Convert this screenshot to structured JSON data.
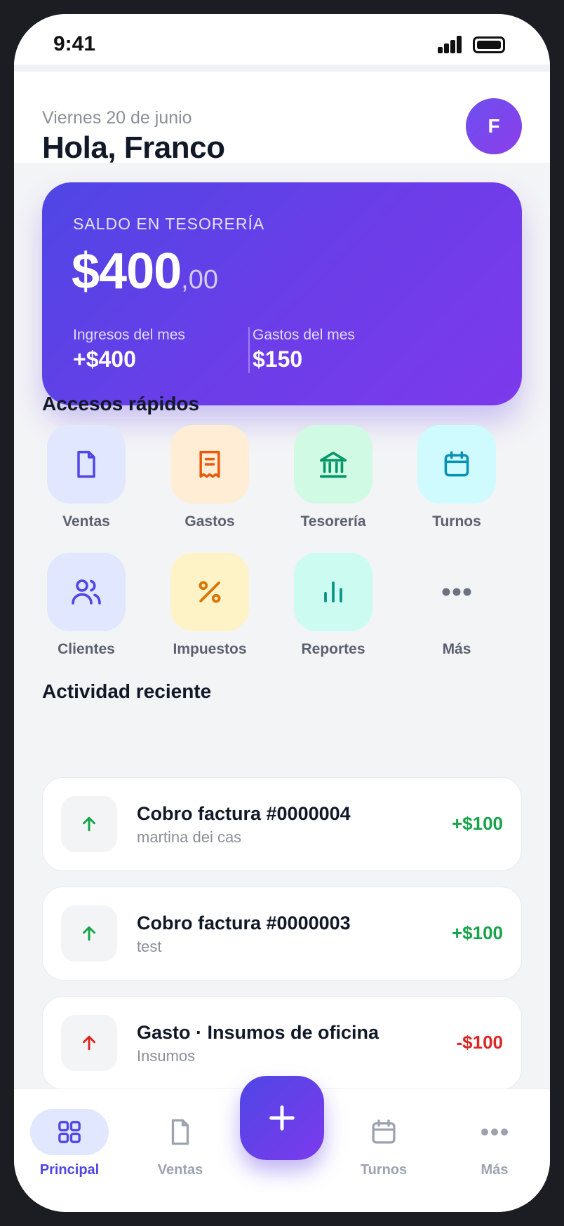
{
  "status_bar": {
    "time": "9:41"
  },
  "header": {
    "date": "Viernes 20 de junio",
    "greeting": "Hola, Franco",
    "avatar_initial": "F"
  },
  "balance": {
    "label": "SALDO EN TESORERÍA",
    "amount": "$400",
    "cents": ",00",
    "income_label": "Ingresos del mes",
    "income_value": "+$400",
    "expenses_label": "Gastos del mes",
    "expenses_value": "$150"
  },
  "quick_access": {
    "title": "Accesos rápidos",
    "items": [
      {
        "label": "Ventas",
        "icon": "document-icon",
        "color": "#4f46e5",
        "bg": "#e0e7ff"
      },
      {
        "label": "Gastos",
        "icon": "receipt-icon",
        "color": "#ea580c",
        "bg": "#ffedd5"
      },
      {
        "label": "Tesorería",
        "icon": "bank-icon",
        "color": "#059669",
        "bg": "#d1fae5"
      },
      {
        "label": "Turnos",
        "icon": "calendar-icon",
        "color": "#0891b2",
        "bg": "#cffafe"
      },
      {
        "label": "Clientes",
        "icon": "users-icon",
        "color": "#4f46e5",
        "bg": "#e0e7ff"
      },
      {
        "label": "Impuestos",
        "icon": "percent-icon",
        "color": "#d97706",
        "bg": "#fef3c7"
      },
      {
        "label": "Reportes",
        "icon": "bar-chart-icon",
        "color": "#0d9488",
        "bg": "#ccfbf1"
      },
      {
        "label": "Más",
        "icon": "more-icon",
        "color": "#6b7280",
        "bg": "transparent"
      }
    ]
  },
  "activity": {
    "title": "Actividad reciente",
    "items": [
      {
        "title": "Cobro factura #0000004",
        "subtitle": "martina dei cas",
        "amount": "+$100",
        "direction": "up",
        "color": "#16a34a"
      },
      {
        "title": "Cobro factura #0000003",
        "subtitle": "test",
        "amount": "+$100",
        "direction": "up",
        "color": "#16a34a"
      },
      {
        "title": "Gasto · Insumos de oficina",
        "subtitle": "Insumos",
        "amount": "-$100",
        "direction": "up",
        "color": "#dc2626"
      }
    ]
  },
  "bottom_nav": {
    "items": [
      {
        "label": "Principal",
        "icon": "grid-icon",
        "active": true
      },
      {
        "label": "Ventas",
        "icon": "document-icon",
        "active": false
      },
      {
        "label": "Turnos",
        "icon": "calendar-icon",
        "active": false
      },
      {
        "label": "Más",
        "icon": "more-icon",
        "active": false
      }
    ],
    "fab_icon": "plus-icon"
  },
  "colors": {
    "accent": "#4f46e5",
    "accent_end": "#7c3aed",
    "positive": "#16a34a",
    "negative": "#dc2626"
  }
}
